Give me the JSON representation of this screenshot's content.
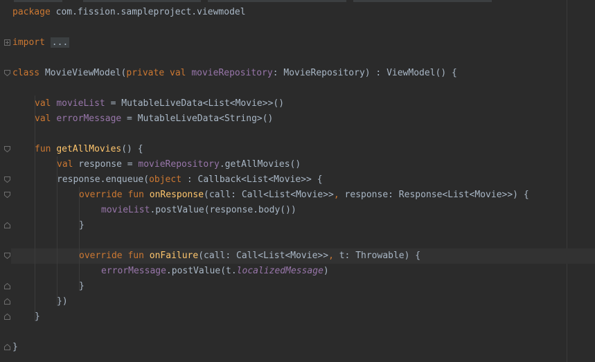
{
  "editor": {
    "package_line": {
      "kw": "package",
      "name": " com.fission.sampleproject.viewmodel"
    },
    "import_line": {
      "kw": "import",
      "sp": " ",
      "folded": "..."
    },
    "class_line": {
      "kw_class": "class",
      "t1": " MovieViewModel(",
      "kw_private": "private",
      "sp1": " ",
      "kw_val": "val",
      "sp2": " ",
      "prop": "movieRepository",
      "t2": ": MovieRepository) : ViewModel() {"
    },
    "movie_list_line": {
      "kw": "val",
      "sp": " ",
      "prop": "movieList",
      "rest": " = MutableLiveData<List<Movie>>()"
    },
    "error_message_line": {
      "kw": "val",
      "sp": " ",
      "prop": "errorMessage",
      "rest": " = MutableLiveData<String>()"
    },
    "fun_line": {
      "kw": "fun",
      "sp": " ",
      "fn": "getAllMovies",
      "rest": "() {"
    },
    "response_line": {
      "kw": "val",
      "t1": " response = ",
      "prop": "movieRepository",
      "rest": ".getAllMovies()"
    },
    "enqueue_line": {
      "t1": "response.enqueue(",
      "kw": "object",
      "rest": " : Callback<List<Movie>> {"
    },
    "on_response_line": {
      "kw1": "override",
      "sp1": " ",
      "kw2": "fun",
      "sp2": " ",
      "fn": "onResponse",
      "t1": "(call: Call<List<Movie>>",
      "comma": ",",
      "rest": " response: Response<List<Movie>>) {"
    },
    "post_value_line": {
      "prop": "movieList",
      "rest": ".postValue(response.body())"
    },
    "close_brace_1": "}",
    "on_failure_line": {
      "kw1": "override",
      "sp1": " ",
      "kw2": "fun",
      "sp2": " ",
      "fn": "onFailure",
      "t1": "(call: Call<List<Movie>>",
      "comma": ",",
      "rest": " t: Throwable) {"
    },
    "error_post_line": {
      "prop": "errorMessage",
      "t1": ".postValue(t.",
      "ital": "localizedMessage",
      "rest": ")"
    },
    "close_brace_2": "}",
    "close_paren": "})",
    "close_brace_3": "}",
    "close_brace_4": "}"
  },
  "colors": {
    "background": "#2b2b2b",
    "keyword": "#cc7832",
    "property": "#9876aa",
    "function": "#ffc66d",
    "default_text": "#a9b7c6"
  }
}
